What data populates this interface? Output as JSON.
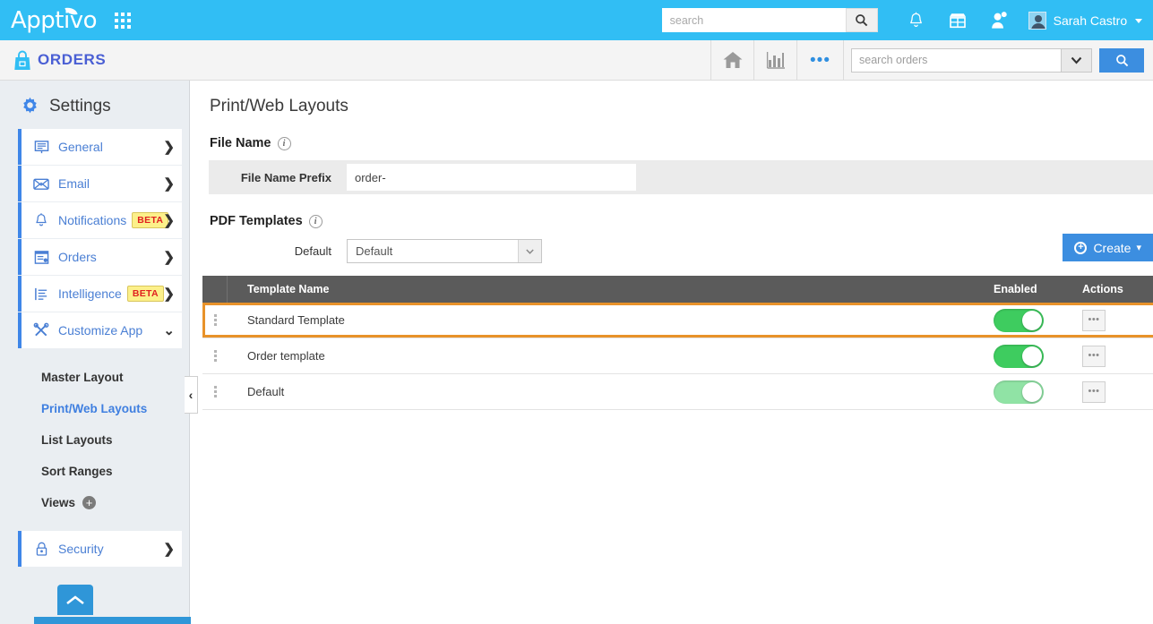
{
  "header": {
    "brand": "Apptivo",
    "apps_icon": "grid-apps-icon",
    "search": {
      "placeholder": "search",
      "value": ""
    },
    "search_button_icon": "search-icon",
    "icons": [
      {
        "name": "notifications-bell-icon",
        "glyph": "bell"
      },
      {
        "name": "store-icon",
        "glyph": "store"
      },
      {
        "name": "user-add-icon",
        "glyph": "user-plus"
      }
    ],
    "user": {
      "name": "Sarah Castro",
      "avatar": "avatar"
    }
  },
  "appbar": {
    "app_icon": "shopping-bag-icon",
    "title": "ORDERS",
    "home_icon": "home-icon",
    "reports_icon": "bar-chart-icon",
    "more_icon": "ellipsis-icon",
    "more_label": "•••",
    "search": {
      "placeholder": "search orders",
      "value": ""
    },
    "dropdown_icon": "chevron-down-icon",
    "go_icon": "search-icon"
  },
  "sidebar": {
    "heading": "Settings",
    "heading_icon": "gear-icon",
    "items": [
      {
        "label": "General",
        "icon": "general-icon",
        "badge": null,
        "chevron": "❯"
      },
      {
        "label": "Email",
        "icon": "email-icon",
        "badge": null,
        "chevron": "❯"
      },
      {
        "label": "Notifications",
        "icon": "bell-icon",
        "badge": "BETA",
        "chevron": "❯"
      },
      {
        "label": "Orders",
        "icon": "orders-icon",
        "badge": null,
        "chevron": "❯"
      },
      {
        "label": "Intelligence",
        "icon": "intelligence-icon",
        "badge": "BETA",
        "chevron": "❯"
      },
      {
        "label": "Customize App",
        "icon": "tools-icon",
        "badge": null,
        "chevron": "⌄"
      }
    ],
    "sub_items": [
      {
        "label": "Master Layout",
        "active": false,
        "add": false
      },
      {
        "label": "Print/Web Layouts",
        "active": true,
        "add": false
      },
      {
        "label": "List Layouts",
        "active": false,
        "add": false
      },
      {
        "label": "Sort Ranges",
        "active": false,
        "add": false
      },
      {
        "label": "Views",
        "active": false,
        "add": true,
        "add_label": "+"
      }
    ],
    "security": {
      "label": "Security",
      "icon": "lock-icon",
      "chevron": "❯"
    },
    "collapse_icon": "chevron-left-icon",
    "collapse_label": "‹",
    "scroll_top_icon": "chevron-up-icon"
  },
  "main": {
    "page_title": "Print/Web Layouts",
    "file_name_section": {
      "heading": "File Name",
      "info_icon": "info-icon",
      "field_label": "File Name Prefix",
      "field_value": "order-",
      "field_placeholder": ""
    },
    "pdf_templates_section": {
      "heading": "PDF Templates",
      "info_icon": "info-icon",
      "default_label": "Default",
      "default_value": "Default",
      "create_button": "Create",
      "create_icon": "circle-plus-icon",
      "create_caret": "▾"
    },
    "table": {
      "columns": [
        "Template Name",
        "Enabled",
        "Actions"
      ],
      "rows": [
        {
          "name": "Standard Template",
          "enabled": true,
          "faded": false,
          "highlighted": true,
          "action_label": "•••"
        },
        {
          "name": "Order template",
          "enabled": true,
          "faded": false,
          "highlighted": false,
          "action_label": "•••"
        },
        {
          "name": "Default",
          "enabled": true,
          "faded": true,
          "highlighted": false,
          "action_label": "•••"
        }
      ]
    }
  },
  "colors": {
    "header_blue": "#31bef4",
    "accent_blue": "#3c8ee0",
    "app_title_blue": "#4a5fd4",
    "table_header_gray": "#5b5b5b",
    "toggle_green": "#3ecc5f",
    "toggle_green_faded": "#90e3a5",
    "highlight_orange": "#e8922a",
    "beta_yellow": "#fcf08a",
    "beta_red": "#e02020",
    "sidebar_bg": "#eaeef2"
  }
}
